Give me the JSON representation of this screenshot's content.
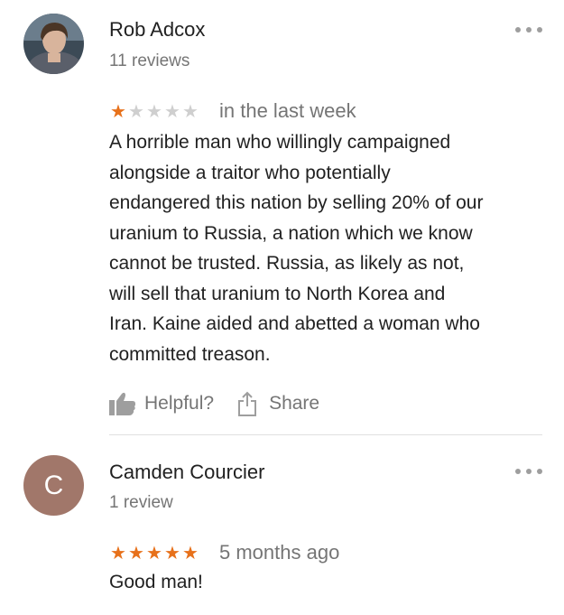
{
  "reviews": [
    {
      "author": "Rob Adcox",
      "review_count": "11 reviews",
      "rating": 1,
      "max_rating": 5,
      "time": "in the last week",
      "text": "A horrible man who willingly campaigned\nalongside a traitor who potentially\nendangered this nation by selling 20% of our\nuranium to Russia, a nation which we know\ncannot be trusted. Russia, as likely as not,\nwill sell that uranium to North Korea and\nIran.  Kaine aided and abetted a woman who\ncommitted treason.",
      "avatar": {
        "type": "photo"
      }
    },
    {
      "author": "Camden Courcier",
      "review_count": "1 review",
      "rating": 5,
      "max_rating": 5,
      "time": "5 months ago",
      "text": "Good man!",
      "avatar": {
        "type": "letter",
        "letter": "C",
        "color": "#a1776a"
      }
    }
  ],
  "actions": {
    "helpful_label": "Helpful?",
    "share_label": "Share"
  },
  "icons": {
    "more": "more-horizontal-icon",
    "helpful": "thumbs-up-icon",
    "share": "share-icon",
    "star": "star-icon"
  },
  "colors": {
    "star_filled": "#e7711b",
    "star_empty": "#cfcfcf",
    "secondary_text": "#757575",
    "primary_text": "#212121"
  }
}
